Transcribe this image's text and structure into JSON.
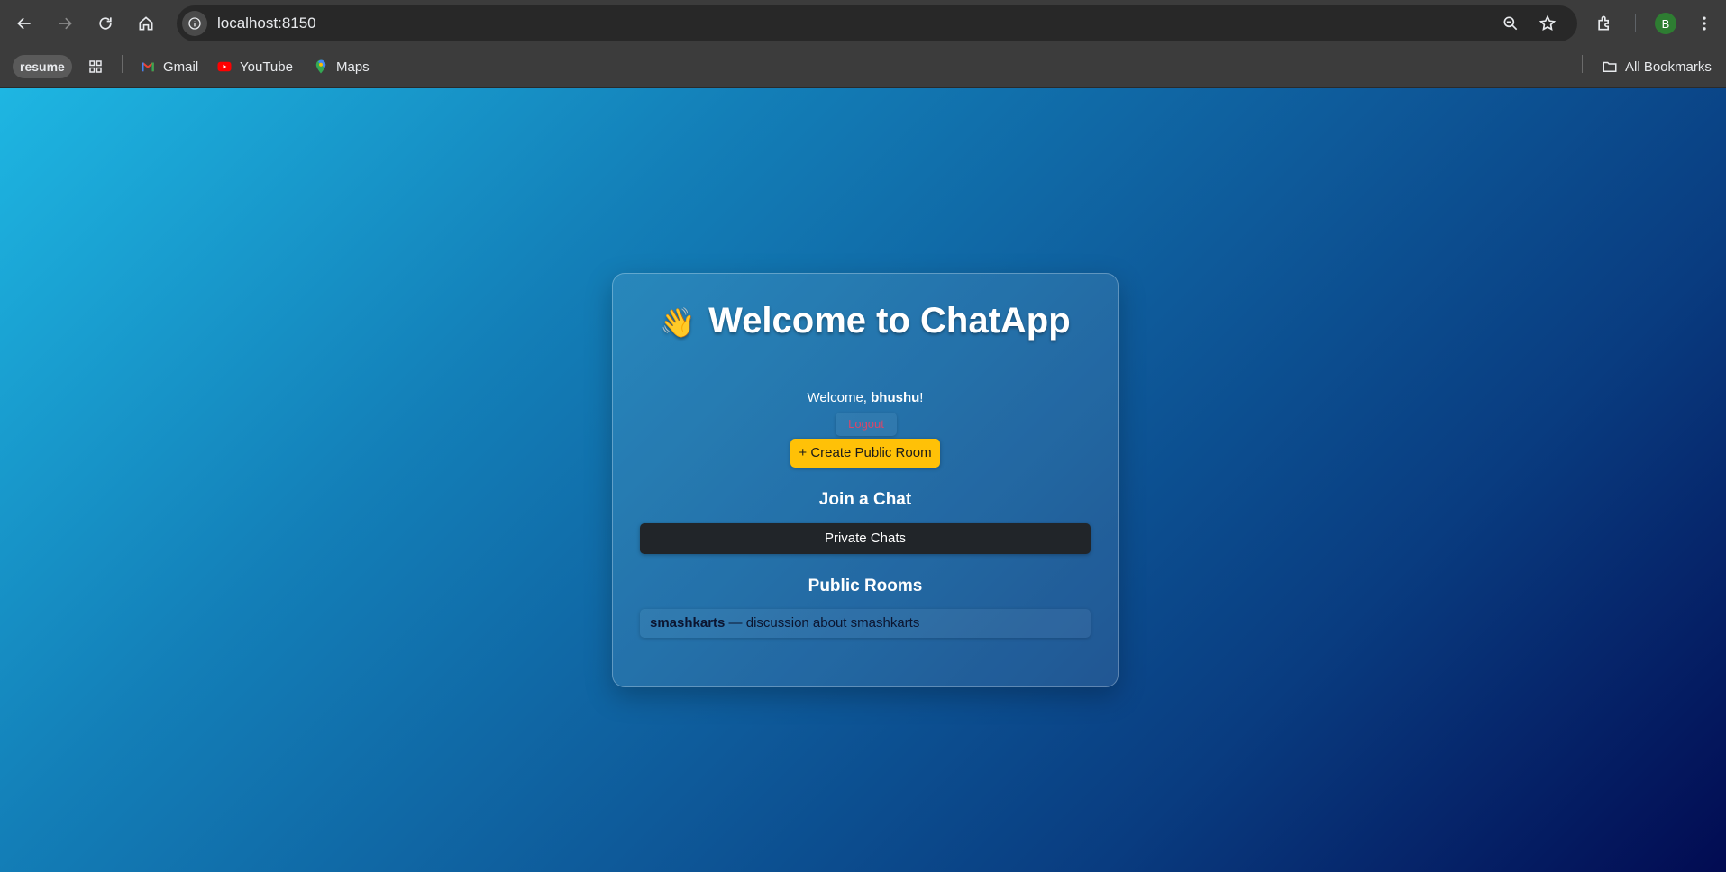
{
  "browser": {
    "url": "localhost:8150",
    "profile_initial": "B",
    "bookmarks": {
      "resume": "resume",
      "gmail": "Gmail",
      "youtube": "YouTube",
      "maps": "Maps",
      "all_bookmarks": "All Bookmarks"
    }
  },
  "app": {
    "title_emoji": "👋",
    "title": "Welcome to ChatApp",
    "welcome_prefix": "Welcome, ",
    "username": "bhushu",
    "welcome_suffix": "!",
    "logout_label": "Logout",
    "create_room_label": "+ Create Public Room",
    "join_heading": "Join a Chat",
    "private_chats_label": "Private Chats",
    "public_rooms_heading": "Public Rooms",
    "public_rooms": [
      {
        "name": "smashkarts",
        "separator": " — ",
        "description": "discussion about smashkarts"
      }
    ]
  },
  "colors": {
    "accent_yellow": "#ffc107",
    "dark_button": "#212529",
    "logout_text": "#d9466a"
  }
}
